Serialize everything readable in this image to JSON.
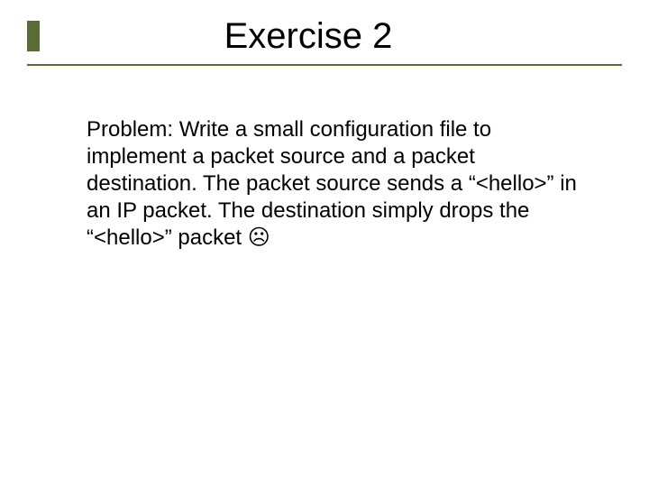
{
  "slide": {
    "title": "Exercise 2",
    "body": "Problem: Write a small configuration file to implement a packet source and a packet destination. The packet source sends a “<hello>” in an IP packet. The destination simply drops the “<hello>” packet ☹"
  }
}
